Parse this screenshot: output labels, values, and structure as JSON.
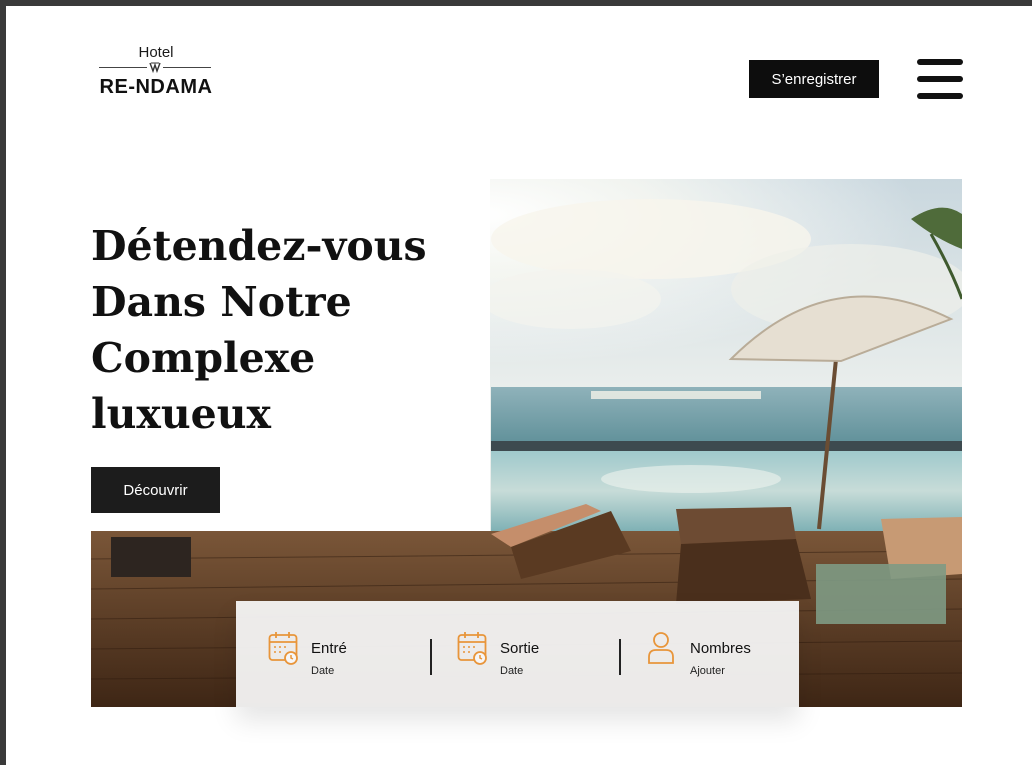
{
  "header": {
    "logo_top": "Hotel",
    "logo_name": "RE-NDAMA",
    "register_label": "S’enregistrer"
  },
  "hero": {
    "title": "Détendez-vous Dans Notre Complexe luxueux",
    "cta_label": "Découvrir"
  },
  "booking": {
    "fields": [
      {
        "label": "Entré",
        "sub": "Date",
        "icon": "calendar-clock-icon"
      },
      {
        "label": "Sortie",
        "sub": "Date",
        "icon": "calendar-clock-icon"
      },
      {
        "label": "Nombres",
        "sub": "Ajouter",
        "icon": "user-icon"
      }
    ]
  },
  "colors": {
    "accent": "#e8953a",
    "button_dark": "#0d0d0d",
    "text": "#111111"
  }
}
